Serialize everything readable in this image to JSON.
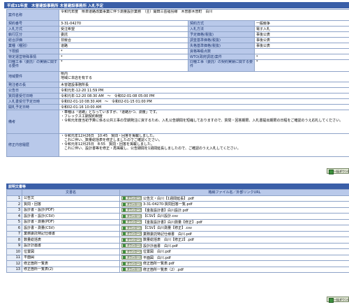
{
  "page_title": "平成31年度　木曽建設事務所 木曽建設事務所 入札予定",
  "info": {
    "project_name_label": "案件名称",
    "project_name": "令和元年度　県単道路改築事業に伴う測量設計業務　（主）開田三岳福島線　木曽郡木曽町　白川",
    "contract_no_label": "契約番号",
    "contract_no": "3-31-04270",
    "contract_type_label": "契約方式",
    "contract_type": "一般競争",
    "bid_method_label": "入札方式",
    "bid_method": "受注希望",
    "bid_style_label": "入札方法",
    "bid_style": "電子入札",
    "proc_type_label": "執行区分",
    "proc_type": "委託",
    "est_price_label": "予定価格(税抜)",
    "est_price": "事後公表",
    "area_label": "総合評価",
    "area": "非競合",
    "survey_price_label": "調査基準価格(税抜)",
    "survey_price": "事後公表",
    "category_label": "業種（種別）",
    "category": "道路",
    "min_price_label": "失格基準価格(税抜)",
    "min_price": "事後公表",
    "rank_label": "下限額",
    "rank": "*",
    "qual_count_label": "資格等級点数",
    "qual_count": "",
    "special_label": "特定運営特殊事情",
    "special": "*",
    "wto_label": "WTO(政府調達)案件",
    "wto": "*",
    "similar_label": "同種工事（委託）の実績に関する要件",
    "similar": "*",
    "similar2_label": "同種工事（委託）の契約実績に関する要件",
    "similar2": "*",
    "region_label": "地域要件",
    "region": "県内\n地域に本店を有する",
    "office_label": "発注者の長",
    "office": "木曽建設事務所長",
    "pub_date_label": "公告日",
    "pub_date": "令和元年-12-20 11:59 PM",
    "question_label": "質問書受付日時",
    "question": "令和元年-12-20 08:30 AM　～　令和02-01-08 05:00 PM",
    "apply_label": "入札書受付予定日時",
    "apply": "令和02-01-10 08:30 AM　～　令和02-01-15 01:00 PM",
    "open_label": "開札予定日時",
    "open": "令和02-01-16 10:00 AM",
    "notes_label": "備考",
    "notes": "・車種は「道路」となっていますが、「道路かつ、測量」です。\n・フレックス工期契約制度\n・令和元年度当初予算に係る公共工事の早期発注に資するため、入札公告期間を短縮しておりますので、質問・回答期限、入札書提出期限の日程をご確認のうえ応札してください。",
    "revision_label": "修正内容履歴",
    "revision": "・令和元年12月26日　10:45　質問・回答を掲載しました。\n　これに伴い、数量総括表を修正しましたのでご確認ください。\n・令和元年12月25日　8:55　質問・回答を掲載しました。\n　これに伴い、設計書等を修正・再掲載し、公告期間を1週間延長しましたので、ご確認のうえ入札してください。"
  },
  "download_all_label": "一括ダウンロード",
  "docs_section_title": "説明文書等",
  "docs_headers": {
    "no": "",
    "name": "文書名",
    "file": "格納ファイル名／外部リンクURL"
  },
  "download_label": "ダウンロード",
  "docs": [
    {
      "no": "1",
      "name": "公告文",
      "file": "公告文・白川【1週間延長】.pdf"
    },
    {
      "no": "2",
      "name": "質問・回答",
      "file": "3-31-04270-質問回答一覧.pdf"
    },
    {
      "no": "3",
      "name": "設計書・設計(PDF)",
      "file": "【金抜設計書】白川設計.pdf"
    },
    {
      "no": "4",
      "name": "設計書・設計(CSV)",
      "file": "【CSV】白川設計.csv"
    },
    {
      "no": "5",
      "name": "設計書・測量(PDF)",
      "file": "【金抜設計書】白川測量【修正】.pdf"
    },
    {
      "no": "6",
      "name": "設計書・測量(CSV)",
      "file": "【CSV】白川測量【修正】.csv"
    },
    {
      "no": "7",
      "name": "業務委託特記仕様書",
      "file": "業務委託特記仕様書　白川.pdf"
    },
    {
      "no": "8",
      "name": "数量総括表",
      "file": "数量総括表　白川【修正2】.pdf"
    },
    {
      "no": "9",
      "name": "設計計画書",
      "file": "設計計画書　白川.pdf"
    },
    {
      "no": "10",
      "name": "位置図",
      "file": "位置図　白川.pdf"
    },
    {
      "no": "11",
      "name": "平面図",
      "file": "平面図　白川.pdf"
    },
    {
      "no": "12",
      "name": "修正箇所一覧表",
      "file": "修正箇所一覧表.pdf"
    },
    {
      "no": "13",
      "name": "修正箇所一覧表(2)",
      "file": "修正箇所一覧表（2）.pdf"
    }
  ]
}
